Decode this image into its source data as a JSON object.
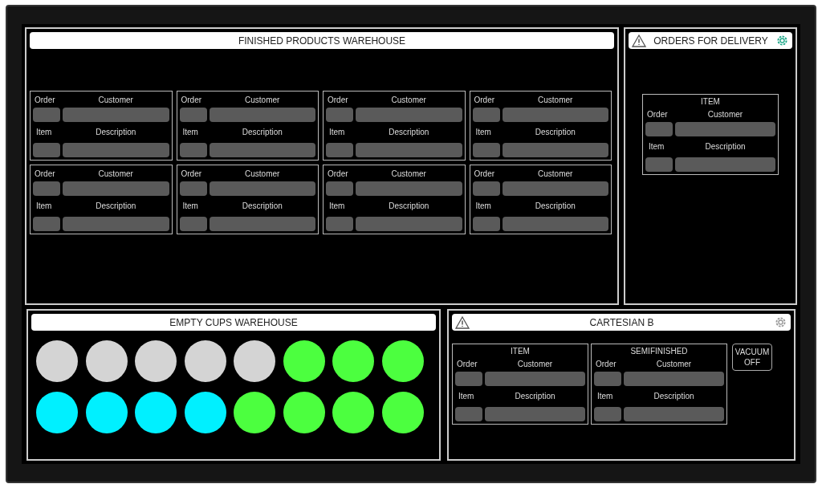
{
  "finished_products": {
    "title": "FINISHED PRODUCTS WAREHOUSE",
    "cards": [
      {
        "order_label": "Order",
        "customer_label": "Customer",
        "item_label": "Item",
        "description_label": "Description"
      },
      {
        "order_label": "Order",
        "customer_label": "Customer",
        "item_label": "Item",
        "description_label": "Description"
      },
      {
        "order_label": "Order",
        "customer_label": "Customer",
        "item_label": "Item",
        "description_label": "Description"
      },
      {
        "order_label": "Order",
        "customer_label": "Customer",
        "item_label": "Item",
        "description_label": "Description"
      },
      {
        "order_label": "Order",
        "customer_label": "Customer",
        "item_label": "Item",
        "description_label": "Description"
      },
      {
        "order_label": "Order",
        "customer_label": "Customer",
        "item_label": "Item",
        "description_label": "Description"
      },
      {
        "order_label": "Order",
        "customer_label": "Customer",
        "item_label": "Item",
        "description_label": "Description"
      },
      {
        "order_label": "Order",
        "customer_label": "Customer",
        "item_label": "Item",
        "description_label": "Description"
      }
    ]
  },
  "orders_for_delivery": {
    "title": "ORDERS FOR DELIVERY",
    "gear_on": true,
    "card": {
      "heading": "ITEM",
      "order_label": "Order",
      "customer_label": "Customer",
      "item_label": "Item",
      "description_label": "Description"
    }
  },
  "empty_cups_warehouse": {
    "title": "EMPTY CUPS WAREHOUSE",
    "cups": [
      {
        "color": "#d4d4d4"
      },
      {
        "color": "#d4d4d4"
      },
      {
        "color": "#d4d4d4"
      },
      {
        "color": "#d4d4d4"
      },
      {
        "color": "#d4d4d4"
      },
      {
        "color": "#4cff3f"
      },
      {
        "color": "#4cff3f"
      },
      {
        "color": "#4cff3f"
      },
      {
        "color": "#00f0ff"
      },
      {
        "color": "#00f0ff"
      },
      {
        "color": "#00f0ff"
      },
      {
        "color": "#00f0ff"
      },
      {
        "color": "#4cff3f"
      },
      {
        "color": "#4cff3f"
      },
      {
        "color": "#4cff3f"
      },
      {
        "color": "#4cff3f"
      }
    ]
  },
  "cartesian_b": {
    "title": "CARTESIAN B",
    "gear_on": false,
    "cards": [
      {
        "heading": "ITEM",
        "order_label": "Order",
        "customer_label": "Customer",
        "item_label": "Item",
        "description_label": "Description"
      },
      {
        "heading": "SEMIFINISHED",
        "order_label": "Order",
        "customer_label": "Customer",
        "item_label": "Item",
        "description_label": "Description"
      }
    ],
    "vacuum_button": "VACUUM OFF"
  }
}
